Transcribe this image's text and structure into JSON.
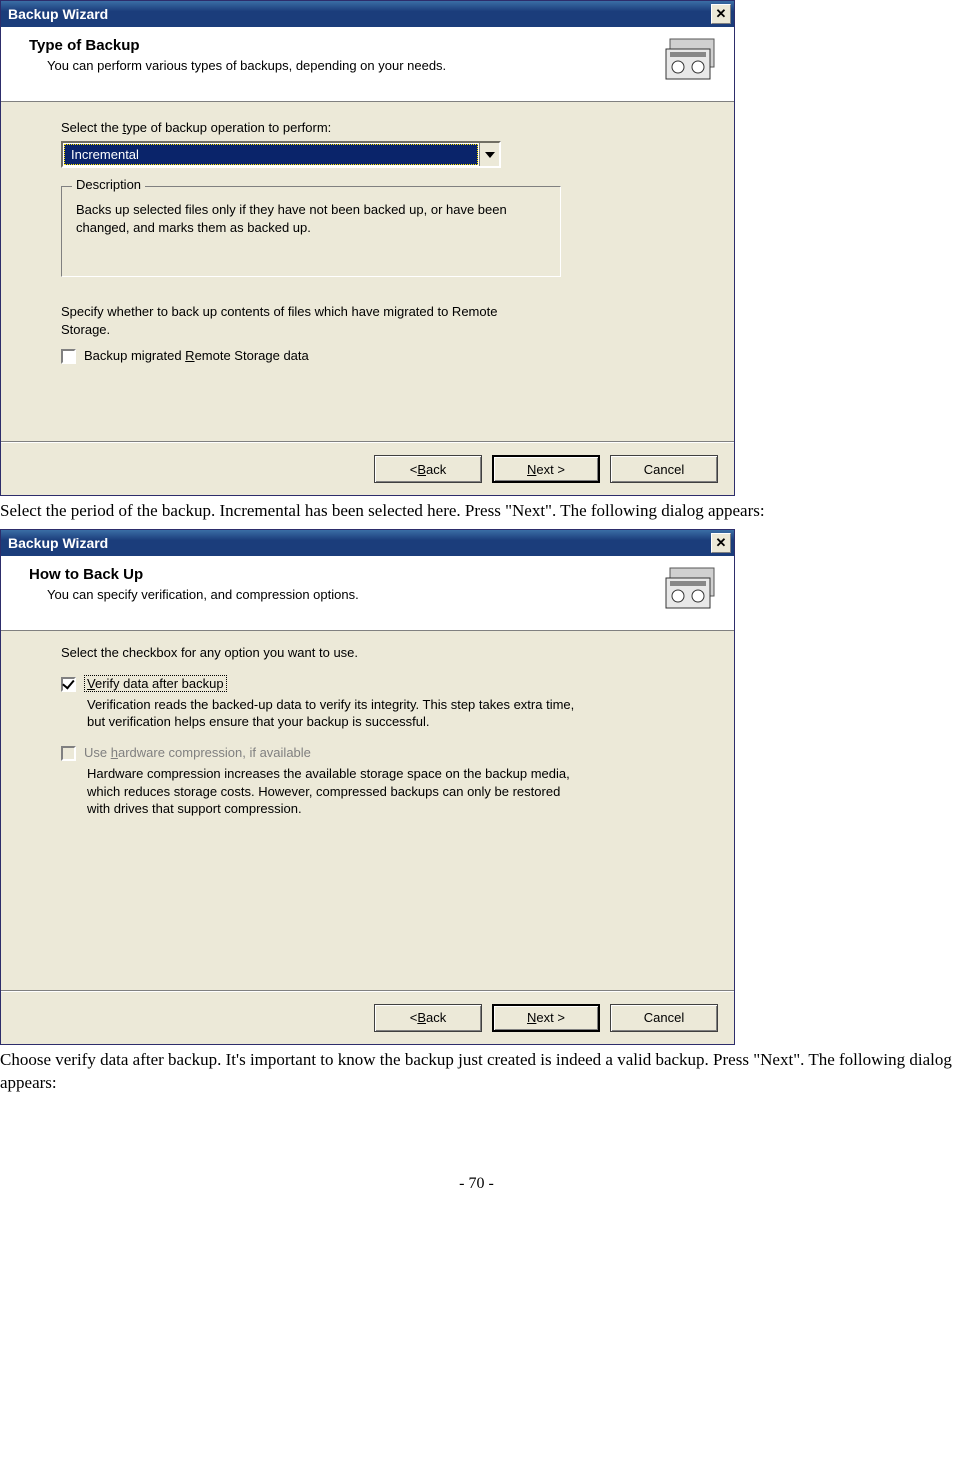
{
  "doc": {
    "caption1": "Select the period of the backup.  Incremental has been selected here.  Press \"Next\".  The following dialog appears:",
    "caption2": "Choose verify data after backup.    It's important to know the backup just created is indeed a valid backup. Press \"Next\".  The following dialog appears:",
    "page_number": "- 70 -"
  },
  "dialog1": {
    "title": "Backup Wizard",
    "header_title": "Type of Backup",
    "header_sub": "You can perform various types of backups, depending on your needs.",
    "label_select": "Select the type of backup operation to perform:",
    "combo_value": "Incremental",
    "group_legend": "Description",
    "group_text": "Backs up selected files only if they have not been backed up, or have been changed, and marks them as backed up.",
    "note_text": "Specify whether to back up contents of files which have migrated to Remote Storage.",
    "chk_label": "Backup migrated Remote Storage data",
    "btn_back": "< Back",
    "btn_next": "Next >",
    "btn_cancel": "Cancel"
  },
  "dialog2": {
    "title": "Backup Wizard",
    "header_title": "How to Back Up",
    "header_sub": "You can specify verification, and compression options.",
    "label_select": "Select the checkbox for any option you want to use.",
    "opt1_label": "Verify data after backup",
    "opt1_desc": "Verification reads the backed-up data to verify its integrity. This step takes extra time, but verification helps ensure that your backup is successful.",
    "opt2_label": "Use hardware compression, if available",
    "opt2_desc": "Hardware compression increases the available storage space on the backup media, which reduces storage costs. However, compressed backups can only be restored with drives that support compression.",
    "btn_back": "< Back",
    "btn_next": "Next >",
    "btn_cancel": "Cancel"
  }
}
